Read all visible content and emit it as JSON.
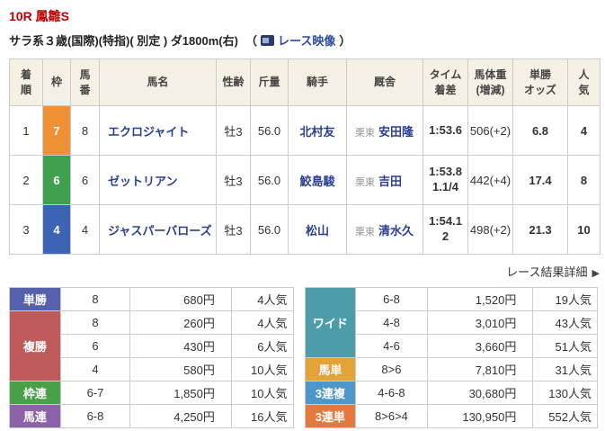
{
  "header": {
    "race_title": "10R 鳳雛S",
    "race_conditions": "サラ系３歳(国際)(特指)( 別定 ) ダ1800m(右)",
    "paren_open": "（",
    "video_link_label": "レース映像",
    "paren_close": "）"
  },
  "results_table": {
    "cols": {
      "finish": "着\n順",
      "frame": "枠",
      "number": "馬\n番",
      "horse": "馬名",
      "sex_age": "性齢",
      "weight": "斤量",
      "jockey": "騎手",
      "stable": "厩舎",
      "time": "タイム\n着差",
      "body_weight": "馬体重\n(増減)",
      "odds": "単勝\nオッズ",
      "popularity": "人\n気"
    },
    "rows": [
      {
        "finish": "1",
        "frame": "7",
        "number": "8",
        "horse": "エクロジャイト",
        "sex_age": "牡3",
        "weight": "56.0",
        "jockey": "北村友",
        "stable_area": "栗東",
        "stable": "安田隆",
        "time": "1:53.6",
        "body_weight": "506(+2)",
        "odds": "6.8",
        "popularity": "4"
      },
      {
        "finish": "2",
        "frame": "6",
        "number": "6",
        "horse": "ゼットリアン",
        "sex_age": "牡3",
        "weight": "56.0",
        "jockey": "鮫島駿",
        "stable_area": "栗東",
        "stable": "吉田",
        "time": "1:53.8\n1.1/4",
        "body_weight": "442(+4)",
        "odds": "17.4",
        "popularity": "8"
      },
      {
        "finish": "3",
        "frame": "4",
        "number": "4",
        "horse": "ジャスパーバローズ",
        "sex_age": "牡3",
        "weight": "56.0",
        "jockey": "松山",
        "stable_area": "栗東",
        "stable": "清水久",
        "time": "1:54.1\n2",
        "body_weight": "498(+2)",
        "odds": "21.3",
        "popularity": "10"
      }
    ]
  },
  "detail_link": {
    "label": "レース結果詳細",
    "arrow": "▶"
  },
  "payouts_left": {
    "tansho": {
      "label": "単勝",
      "combo": "8",
      "amount": "680円",
      "pop": "4人気"
    },
    "fukusho": {
      "label": "複勝",
      "rows": [
        {
          "combo": "8",
          "amount": "260円",
          "pop": "4人気"
        },
        {
          "combo": "6",
          "amount": "430円",
          "pop": "6人気"
        },
        {
          "combo": "4",
          "amount": "580円",
          "pop": "10人気"
        }
      ]
    },
    "wakuren": {
      "label": "枠連",
      "combo": "6-7",
      "amount": "1,850円",
      "pop": "10人気"
    },
    "umaren": {
      "label": "馬連",
      "combo": "6-8",
      "amount": "4,250円",
      "pop": "16人気"
    }
  },
  "payouts_right": {
    "wide": {
      "label": "ワイド",
      "rows": [
        {
          "combo": "6-8",
          "amount": "1,520円",
          "pop": "19人気"
        },
        {
          "combo": "4-8",
          "amount": "3,010円",
          "pop": "43人気"
        },
        {
          "combo": "4-6",
          "amount": "3,660円",
          "pop": "51人気"
        }
      ]
    },
    "umatan": {
      "label": "馬単",
      "combo": "8>6",
      "amount": "7,810円",
      "pop": "31人気"
    },
    "sanrenpuku": {
      "label": "3連複",
      "combo": "4-6-8",
      "amount": "30,680円",
      "pop": "130人気"
    },
    "sanrentan": {
      "label": "3連単",
      "combo": "8>6>4",
      "amount": "130,950円",
      "pop": "552人気"
    }
  },
  "colors": {
    "title_red": "#c00000",
    "frame_7": "#ef9237",
    "frame_6": "#3fa04f",
    "frame_4": "#3d64b4",
    "tansho": "#5661ae",
    "fukusho": "#c05a5a",
    "wakuren": "#48a048",
    "umaren": "#8c62a8",
    "wide": "#4d9da8",
    "umatan": "#e3a336",
    "sanrenpuku": "#4e97c9",
    "sanrentan": "#e4793f"
  }
}
